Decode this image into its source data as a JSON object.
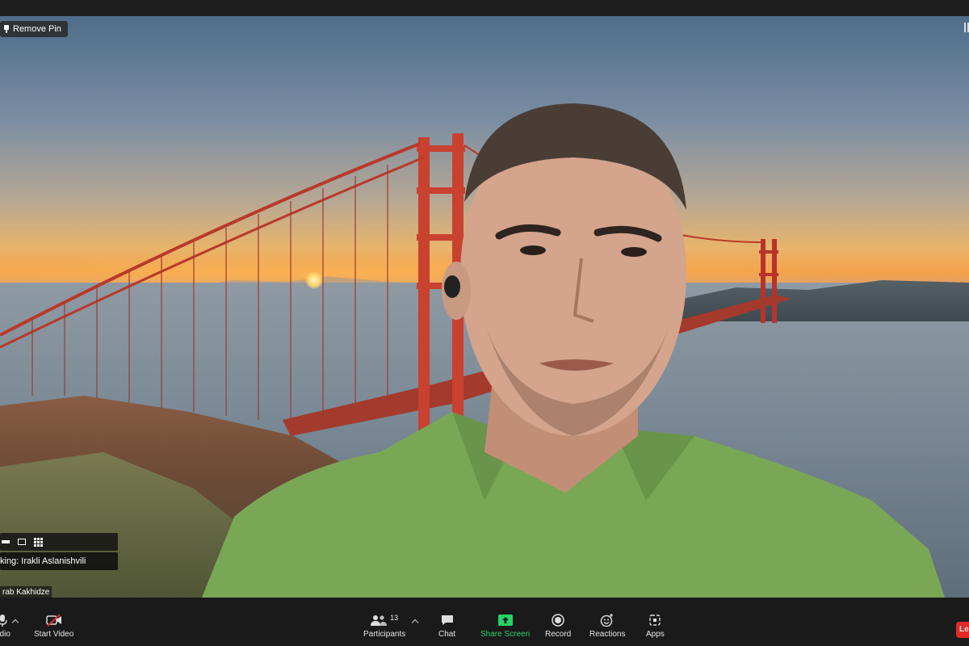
{
  "meeting": {
    "pin_label": "Remove Pin",
    "speaking_label": "king: Irakli Aslanishvili",
    "participant_name": "rab Kakhidze"
  },
  "toolbar": {
    "audio_label": "udio",
    "video_label": "Start Video",
    "participants_label": "Participants",
    "participants_count": "13",
    "chat_label": "Chat",
    "share_label": "Share Screen",
    "record_label": "Record",
    "reactions_label": "Reactions",
    "apps_label": "Apps",
    "leave_label": "Le"
  },
  "icons": {
    "pin": "pin-icon",
    "microphone": "microphone-icon",
    "video_off": "video-off-icon",
    "participants": "participants-icon",
    "chat": "chat-icon",
    "share": "share-screen-icon",
    "record": "record-icon",
    "reactions": "reactions-icon",
    "apps": "apps-icon"
  },
  "colors": {
    "toolbar_bg": "#1a1a1a",
    "share_accent": "#25d366",
    "leave_red": "#e02828",
    "video_off_red": "#e02828"
  }
}
